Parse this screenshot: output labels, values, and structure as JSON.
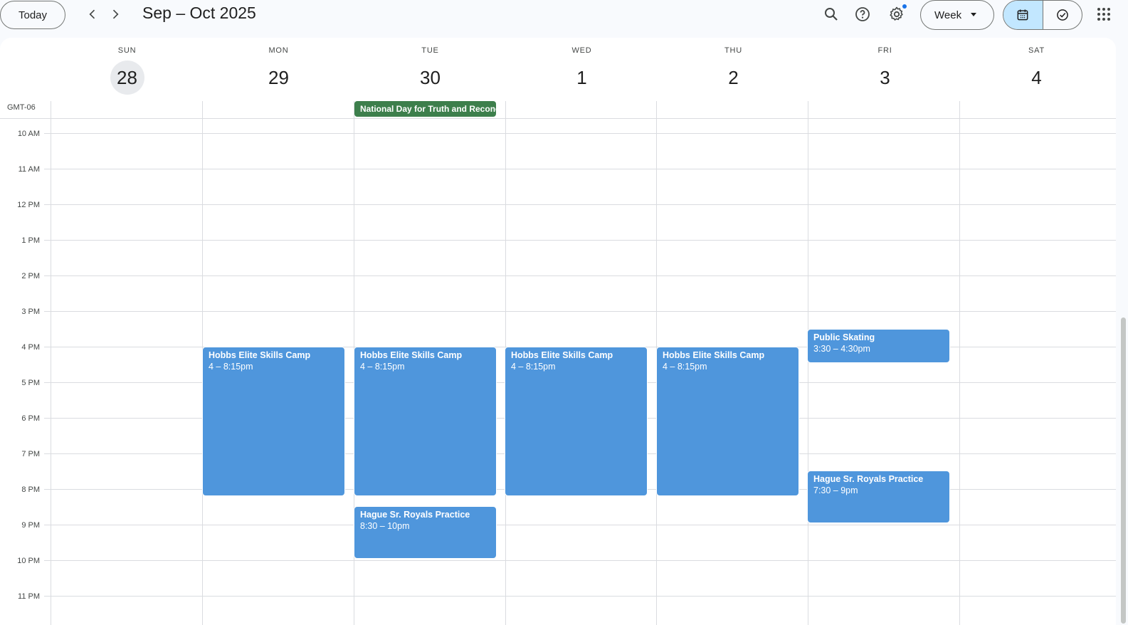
{
  "toolbar": {
    "today_label": "Today",
    "prev_icon": "chevron-left-icon",
    "next_icon": "chevron-right-icon",
    "range_title": "Sep – Oct 2025",
    "search_icon": "search-icon",
    "help_icon": "help-icon",
    "settings_icon": "gear-icon",
    "view_selected": "Week",
    "calendar_view_icon": "calendar-icon",
    "tasks_view_icon": "task-check-icon",
    "apps_icon": "apps-grid-icon"
  },
  "timezone": "GMT-06",
  "days": [
    {
      "dow": "SUN",
      "num": "28",
      "today": true
    },
    {
      "dow": "MON",
      "num": "29"
    },
    {
      "dow": "TUE",
      "num": "30"
    },
    {
      "dow": "WED",
      "num": "1"
    },
    {
      "dow": "THU",
      "num": "2"
    },
    {
      "dow": "FRI",
      "num": "3"
    },
    {
      "dow": "SAT",
      "num": "4"
    }
  ],
  "all_day_events": [
    {
      "title": "National Day for Truth and Reconciliation",
      "day": "TUE",
      "color": "#3d7f4c"
    }
  ],
  "hours": [
    "10 AM",
    "11 AM",
    "12 PM",
    "1 PM",
    "2 PM",
    "3 PM",
    "4 PM",
    "5 PM",
    "6 PM",
    "7 PM",
    "8 PM",
    "9 PM",
    "10 PM",
    "11 PM"
  ],
  "events": [
    {
      "title": "Hobbs Elite Skills Camp",
      "time": "4 – 8:15pm",
      "day": "MON"
    },
    {
      "title": "Hobbs Elite Skills Camp",
      "time": "4 – 8:15pm",
      "day": "TUE"
    },
    {
      "title": "Hobbs Elite Skills Camp",
      "time": "4 – 8:15pm",
      "day": "WED"
    },
    {
      "title": "Hobbs Elite Skills Camp",
      "time": "4 – 8:15pm",
      "day": "THU"
    },
    {
      "title": "Public Skating",
      "time": "3:30 – 4:30pm",
      "day": "FRI"
    },
    {
      "title": "Hague Sr. Royals Practice",
      "time": "8:30 – 10pm",
      "day": "TUE"
    },
    {
      "title": "Hague Sr. Royals Practice",
      "time": "7:30 – 9pm",
      "day": "FRI"
    }
  ],
  "colors": {
    "event_blue": "#4f96dc",
    "allday_green": "#3d7f4c",
    "accent": "#1a73e8",
    "active_segment": "#c2e7ff"
  }
}
